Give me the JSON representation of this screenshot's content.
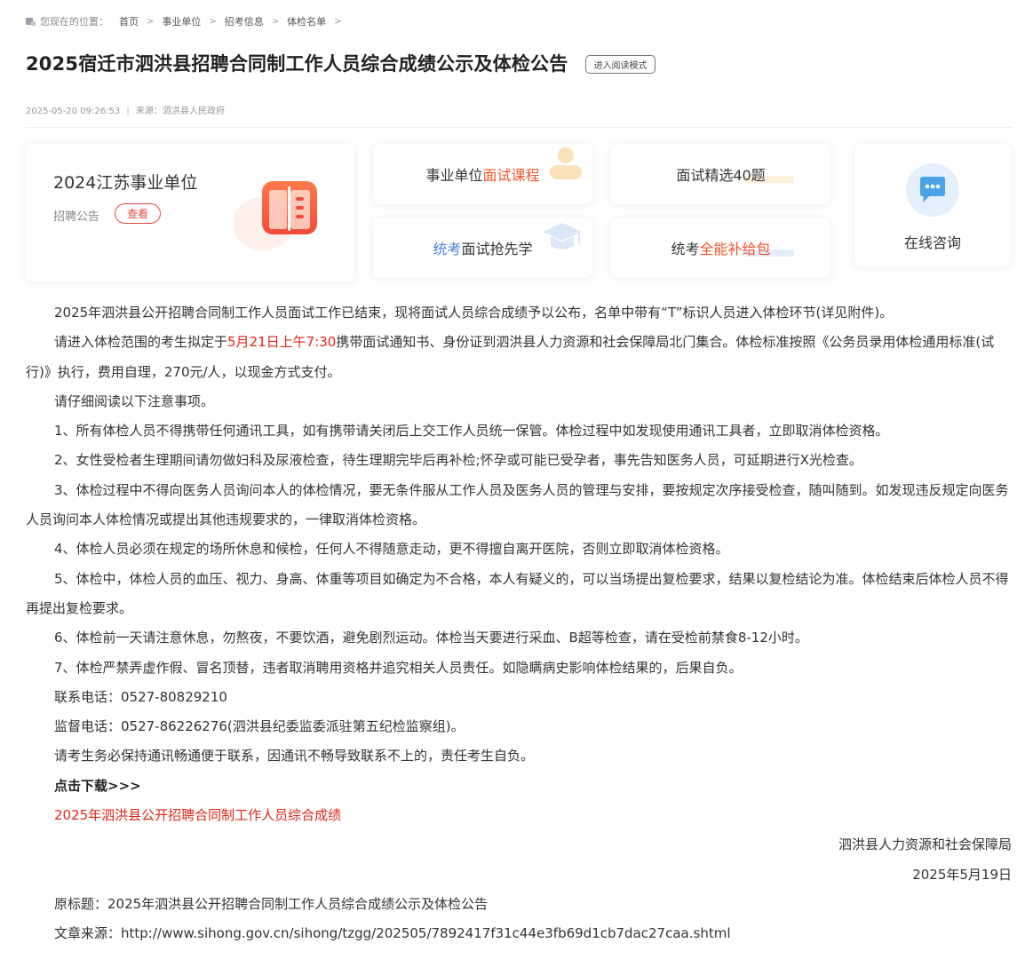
{
  "breadcrumb": {
    "prefix": "您现在的位置：",
    "items": [
      "首页",
      "事业单位",
      "招考信息",
      "体检名单"
    ],
    "separator": ">"
  },
  "article": {
    "title": "2025宿迁市泗洪县招聘合同制工作人员综合成绩公示及体检公告",
    "read_mode_label": "进入阅读模式",
    "datetime": "2025-05-20 09:26:53",
    "source": "来源：泗洪县人民政府"
  },
  "promo": {
    "big_card": {
      "title": "2024江苏事业单位",
      "sub_label": "招聘公告",
      "button_label": "查看"
    },
    "card1": {
      "text_a": "事业单位",
      "text_b": "面试课程"
    },
    "card2": {
      "text": "面试精选40题"
    },
    "card3": {
      "text_a": "统考",
      "text_b": "面试抢先学"
    },
    "card4": {
      "text_a": "统考",
      "text_b": "全能补给包"
    },
    "consult": {
      "label": "在线咨询"
    }
  },
  "content": {
    "p1": "2025年泗洪县公开招聘合同制工作人员面试工作已结束，现将面试人员综合成绩予以公布，名单中带有“T”标识人员进入体检环节(详见附件)。",
    "p2_a": "请进入体检范围的考生拟定于",
    "p2_time": "5月21日上午7:30",
    "p2_b": "携带面试通知书、身份证到泗洪县人力资源和社会保障局北门集合。体检标准按照《公务员录用体检通用标准(试行)》执行，费用自理，270元/人，以现金方式支付。",
    "p3": "请仔细阅读以下注意事项。",
    "n1": "1、所有体检人员不得携带任何通讯工具，如有携带请关闭后上交工作人员统一保管。体检过程中如发现使用通讯工具者，立即取消体检资格。",
    "n2": "2、女性受检者生理期间请勿做妇科及尿液检查，待生理期完毕后再补检;怀孕或可能已受孕者，事先告知医务人员，可延期进行X光检查。",
    "n3": "3、体检过程中不得向医务人员询问本人的体检情况，要无条件服从工作人员及医务人员的管理与安排，要按规定次序接受检查，随叫随到。如发现违反规定向医务人员询问本人体检情况或提出其他违规要求的，一律取消体检资格。",
    "n4": "4、体检人员必须在规定的场所休息和候检，任何人不得随意走动，更不得擅自离开医院，否则立即取消体检资格。",
    "n5": "5、体检中，体检人员的血压、视力、身高、体重等项目如确定为不合格，本人有疑义的，可以当场提出复检要求，结果以复检结论为准。体检结束后体检人员不得再提出复检要求。",
    "n6": "6、体检前一天请注意休息，勿熬夜，不要饮酒，避免剧烈运动。体检当天要进行采血、B超等检查，请在受检前禁食8-12小时。",
    "n7": "7、体检严禁弄虚作假、冒名顶替，违者取消聘用资格并追究相关人员责任。如隐瞒病史影响体检结果的，后果自负。",
    "contact_phone": "联系电话：0527-80829210",
    "supervise_phone": "监督电话：0527-86226276(泗洪县纪委监委派驻第五纪检监察组)。",
    "reminder": "请考生务必保持通讯畅通便于联系，因通讯不畅导致联系不上的，责任考生自负。",
    "download_label": "点击下载>>>",
    "download_link": "2025年泗洪县公开招聘合同制工作人员综合成绩",
    "signature_org": "泗洪县人力资源和社会保障局",
    "signature_date": "2025年5月19日",
    "original_title": "原标题：2025年泗洪县公开招聘合同制工作人员综合成绩公示及体检公告",
    "article_source": "文章来源：http://www.sihong.gov.cn/sihong/tzgg/202505/7892417f31c44e3fb69d1cb7dac27caa.shtml"
  },
  "colors": {
    "accent_red": "#e0261a",
    "promo_orange": "#f0552c",
    "promo_blue": "#4a7fd6"
  },
  "icons": [
    "location-icon",
    "book-icon",
    "person-icon",
    "graduation-cap-icon",
    "chat-bubble-icon"
  ]
}
